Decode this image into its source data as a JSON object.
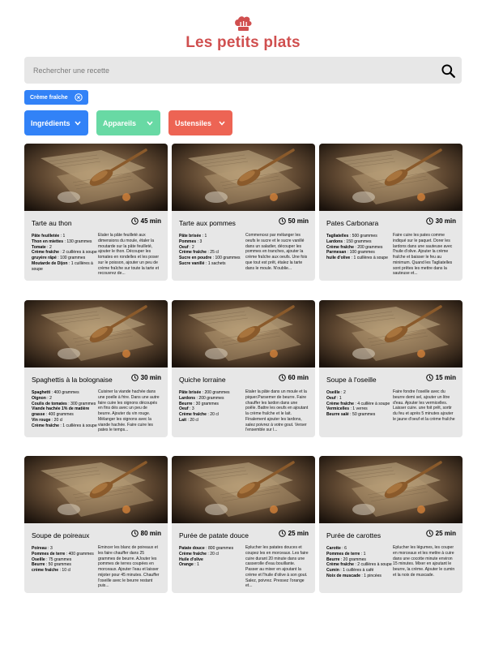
{
  "brand": {
    "title": "Les petits plats",
    "logo_icon": "chef-hat-icon",
    "color": "#D04F4F"
  },
  "search": {
    "placeholder": "Rechercher une recette",
    "value": "",
    "icon": "search-icon"
  },
  "tags": [
    {
      "label": "Crème fraîche",
      "color": "#3282F7"
    }
  ],
  "filters": [
    {
      "label": "Ingrédients",
      "color": "#3282F7"
    },
    {
      "label": "Appareils",
      "color": "#68D9A4"
    },
    {
      "label": "Ustensiles",
      "color": "#ED6454"
    }
  ],
  "recipes": [
    {
      "title": "Tarte au thon",
      "time": "45 min",
      "ingredients": [
        {
          "name": "Pâte feuilletée",
          "qty": ": 1"
        },
        {
          "name": "Thon en miettes",
          "qty": ": 130 grammes"
        },
        {
          "name": "Tomate",
          "qty": ": 2"
        },
        {
          "name": "Crème fraîche",
          "qty": ": 2 cuillères à soupe"
        },
        {
          "name": "gruyère râpé",
          "qty": ": 100 grammes"
        },
        {
          "name": "Moutarde de Dijon",
          "qty": ": 1 cuillères à soupe"
        }
      ],
      "description": "Etaler la pâte feuilleté aux dimensions du moule, étaler la moutarde sur la pâte feuilleté, ajouter le thon. Découper les tomates en rondelles et les poser sur le poisson, ajouter un peu de crème fraîche sur toute la tarte et recouvrez de..."
    },
    {
      "title": "Tarte aux pommes",
      "time": "50 min",
      "ingredients": [
        {
          "name": "Pâte brisée",
          "qty": ": 1"
        },
        {
          "name": "Pommes",
          "qty": ": 3"
        },
        {
          "name": "Oeuf",
          "qty": ": 2"
        },
        {
          "name": "Crème fraîche",
          "qty": ": 25 cl"
        },
        {
          "name": "Sucre en poudre",
          "qty": ": 100 grammes"
        },
        {
          "name": "Sucre vanillé",
          "qty": ": 1 sachets"
        }
      ],
      "description": "Commencez par mélanger les oeufs le sucre et le sucre vanillé dans un saladier, découper les pommes en tranches, ajouter la crème fraîche aux oeufs. Une fois que tout est prêt, étalez la tarte dans le moule. N'oublie..."
    },
    {
      "title": "Pates Carbonara",
      "time": "30 min",
      "ingredients": [
        {
          "name": "Tagliatelles",
          "qty": ": 500 grammes"
        },
        {
          "name": "Lardons",
          "qty": ": 150 grammes"
        },
        {
          "name": "Crème fraîche",
          "qty": ": 200 grammes"
        },
        {
          "name": "Parmesan",
          "qty": ": 100 grammes"
        },
        {
          "name": "huile d'olive",
          "qty": ": 1 cuillères à soupe"
        }
      ],
      "description": "Faire cuire les pates comme indiqué sur le paquet. Dorer les lardons dans une sauteuse avec l'huile d'olive. Ajouter la crème fraîche et baisser le feu au minimum. Quand les Tagliatelles sont prêtes les mettre dans la sauteuse et..."
    },
    {
      "title": "Spaghettis à la bolognaise",
      "time": "30 min",
      "ingredients": [
        {
          "name": "Spaghetti",
          "qty": ": 400 grammes"
        },
        {
          "name": "Oignon",
          "qty": ": 2"
        },
        {
          "name": "Coulis de tomates",
          "qty": ": 300 grammes"
        },
        {
          "name": "Viande hachée 1% de matière grasse",
          "qty": ": 400 grammes"
        },
        {
          "name": "Vin rouge",
          "qty": ": 20 cl"
        },
        {
          "name": "Crème fraîche",
          "qty": ": 1 cuillères à soupe"
        }
      ],
      "description": "Cuisiner la viande hachée dans une poelle à frire. Dans une autre faire cuire les oignons découpés en fins dés avec un peu de beurre. Ajouter du vin rouge. Mélanger les oignons avec la viande hachée. Faire cuire les pates le temps..."
    },
    {
      "title": "Quiche lorraine",
      "time": "60 min",
      "ingredients": [
        {
          "name": "Pâte brisée",
          "qty": ": 200 grammes"
        },
        {
          "name": "Lardons",
          "qty": ": 200 grammes"
        },
        {
          "name": "Beurre",
          "qty": ": 30 grammes"
        },
        {
          "name": "Oeuf",
          "qty": ": 3"
        },
        {
          "name": "Crème fraîche",
          "qty": ": 20 cl"
        },
        {
          "name": "Lait",
          "qty": ": 20 cl"
        }
      ],
      "description": "Etaler la pâte dans un moule et la piquer.Parsemer de beurre. Faire chauffer les lardon dans une poêle. Battre les oeufs en ajoutant la crème fraîche et le lait. Finalement ajouter les lardons, salez poivrez à votre gout. Verser l'ensemble sur l..."
    },
    {
      "title": "Soupe à l'oseille",
      "time": "15 min",
      "ingredients": [
        {
          "name": "Oseille",
          "qty": ": 2"
        },
        {
          "name": "Oeuf",
          "qty": ": 1"
        },
        {
          "name": "Crème fraîche",
          "qty": ": 4 cuillère à soupe"
        },
        {
          "name": "Vermicelles",
          "qty": ": 1 verres"
        },
        {
          "name": "Beurre salé",
          "qty": ": 50 grammes"
        }
      ],
      "description": "Faire fondre l'oseille avec du beurre demi sel, ajouter un litre d'eau. Ajouter les vermicelles. Laisser cuire. une foit prêt, sortir du feu et après 5 minutes ajouter le jaune d'oeuf et la crème fraîche"
    },
    {
      "title": "Soupe de poireaux",
      "time": "80 min",
      "ingredients": [
        {
          "name": "Poireau",
          "qty": ": 3"
        },
        {
          "name": "Pommes de terre",
          "qty": ": 400 grammes"
        },
        {
          "name": "Oseille",
          "qty": ": 75 grammes"
        },
        {
          "name": "Beurre",
          "qty": ": 50 grammes"
        },
        {
          "name": "crème fraîche",
          "qty": ": 10 cl"
        }
      ],
      "description": "Émincer les blanc de poireaux et les faire chauffer dans 25 grammes de beurre. AJouter les pommes de terres coupées en morceaux. Ajouter l'eau et laisser mijoter pour 45 minutes. Chauffer l'oseille avec le beurre restant puis..."
    },
    {
      "title": "Purée de patate douce",
      "time": "25 min",
      "ingredients": [
        {
          "name": "Patate douce",
          "qty": ": 800 grammes"
        },
        {
          "name": "Crème fraîche",
          "qty": ": 20 cl"
        },
        {
          "name": "Huile d'olive",
          "qty": ""
        },
        {
          "name": "Orange",
          "qty": ": 1"
        }
      ],
      "description": "Éplucher les patates douces et coupez les en morceaux. Les faire cuire durant 20 minute dans une casserolle d'eau bouillante. Passer au mixer en ajoutant la crème et l'huile d'olive à son gout. Salez, poivrez. Pressez l'orange et..."
    },
    {
      "title": "Purée de carottes",
      "time": "25 min",
      "ingredients": [
        {
          "name": "Carotte",
          "qty": ": 6"
        },
        {
          "name": "Pommes de terre",
          "qty": ": 1"
        },
        {
          "name": "Beurre",
          "qty": ": 20 grammes"
        },
        {
          "name": "Crème fraîche",
          "qty": ": 2 cuillères à soupe"
        },
        {
          "name": "Cumin",
          "qty": ": 1 cuillères à café"
        },
        {
          "name": "Noix de muscade",
          "qty": ": 1 pincées"
        }
      ],
      "description": "Éplucher les légumes, les couper en morceaux et les mettre à cuire dans une cocotte minute environ 15 minutes. Mixer en ajoutant le beurre, la crème. Ajouter le cumin et la noix de muscade."
    }
  ]
}
